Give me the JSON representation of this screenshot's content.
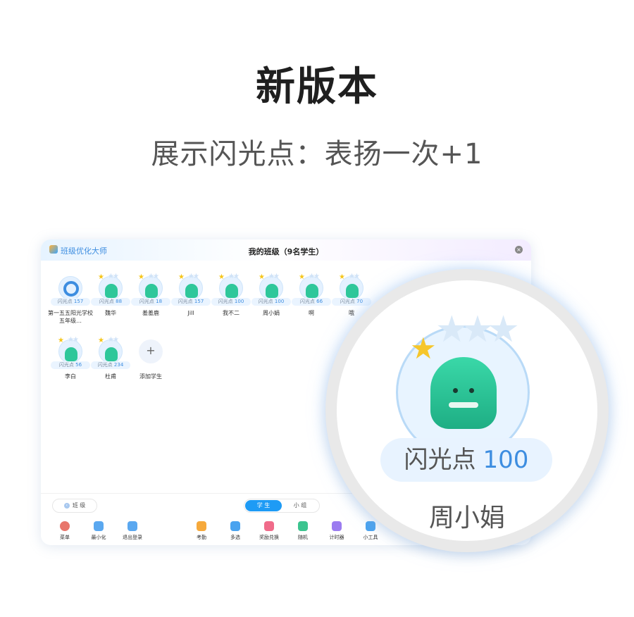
{
  "hero": {
    "title": "新版本",
    "subtitle": "展示闪光点：表扬一次+1"
  },
  "window": {
    "app_name": "班级优化大师",
    "title": "我的班级（9名学生）",
    "close_glyph": "×"
  },
  "points_label": "闪光点",
  "students": [
    {
      "name": "第一五五阳光学校五年级…",
      "points": "157",
      "avatar": "ring-icon"
    },
    {
      "name": "魏华",
      "points": "88",
      "avatar": "monster-icon"
    },
    {
      "name": "羞羞鹿",
      "points": "18",
      "avatar": "monster-icon"
    },
    {
      "name": "Jill",
      "points": "157",
      "avatar": "monster-icon"
    },
    {
      "name": "我不二",
      "points": "100",
      "avatar": "monster-icon"
    },
    {
      "name": "周小娟",
      "points": "100",
      "avatar": "monster-icon"
    },
    {
      "name": "啊",
      "points": "66",
      "avatar": "monster-icon"
    },
    {
      "name": "哦",
      "points": "70",
      "avatar": "monster-icon"
    },
    {
      "name": "李白",
      "points": "56",
      "avatar": "monster-icon"
    },
    {
      "name": "杜甫",
      "points": "234",
      "avatar": "monster-icon"
    }
  ],
  "add_student": {
    "glyph": "+",
    "label": "添加学生"
  },
  "footer": {
    "class_button": "班 级",
    "seg_students": "学 生",
    "seg_groups": "小 组"
  },
  "toolbar": [
    {
      "label": "菜单",
      "color": "#e8766b"
    },
    {
      "label": "最小化",
      "color": "#5aa8f0"
    },
    {
      "label": "退出登录",
      "color": "#5aa8f0"
    },
    {
      "label": "考勤",
      "color": "#f6a93b"
    },
    {
      "label": "多选",
      "color": "#4aa3ef"
    },
    {
      "label": "奖励兑换",
      "color": "#f06b8a"
    },
    {
      "label": "随机",
      "color": "#3cc48f"
    },
    {
      "label": "计时器",
      "color": "#9b7cf0"
    },
    {
      "label": "小工具",
      "color": "#4aa3ef"
    }
  ],
  "zoom": {
    "points": "100",
    "name": "周小娟",
    "star_glyph": "★",
    "stars_glyph": "★★★"
  }
}
